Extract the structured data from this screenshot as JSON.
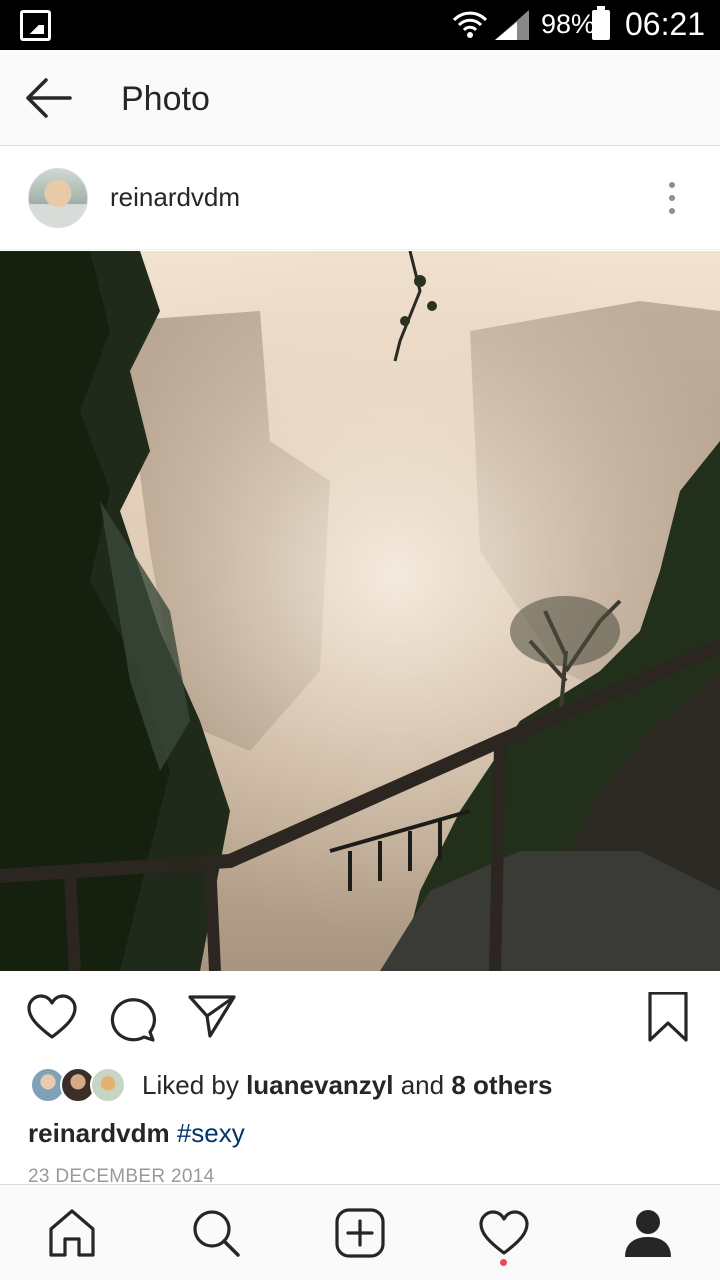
{
  "status_bar": {
    "battery": "98%",
    "time": "06:21",
    "icons": [
      "gallery-icon",
      "wifi-icon",
      "signal-icon",
      "battery-icon"
    ]
  },
  "header": {
    "title": "Photo",
    "back_icon": "arrow-left-icon"
  },
  "post": {
    "username": "reinardvdm",
    "more_icon": "more-vertical-icon",
    "actions": [
      "heart-icon",
      "comment-icon",
      "share-icon",
      "bookmark-icon"
    ],
    "likes": {
      "prefix": "Liked by",
      "first_liker": "luanevanzyl",
      "conjunction": "and",
      "others": "8 others"
    },
    "caption": {
      "username": "reinardvdm",
      "hashtag": "#sexy"
    },
    "date": "23 DECEMBER 2014"
  },
  "bottom_nav": {
    "items": [
      "home-icon",
      "search-icon",
      "add-post-icon",
      "activity-icon",
      "profile-icon"
    ],
    "activity_has_notification": true
  },
  "colors": {
    "hashtag": "#003569",
    "notification_dot": "#ed4956",
    "text": "#262626",
    "muted": "#999999"
  }
}
